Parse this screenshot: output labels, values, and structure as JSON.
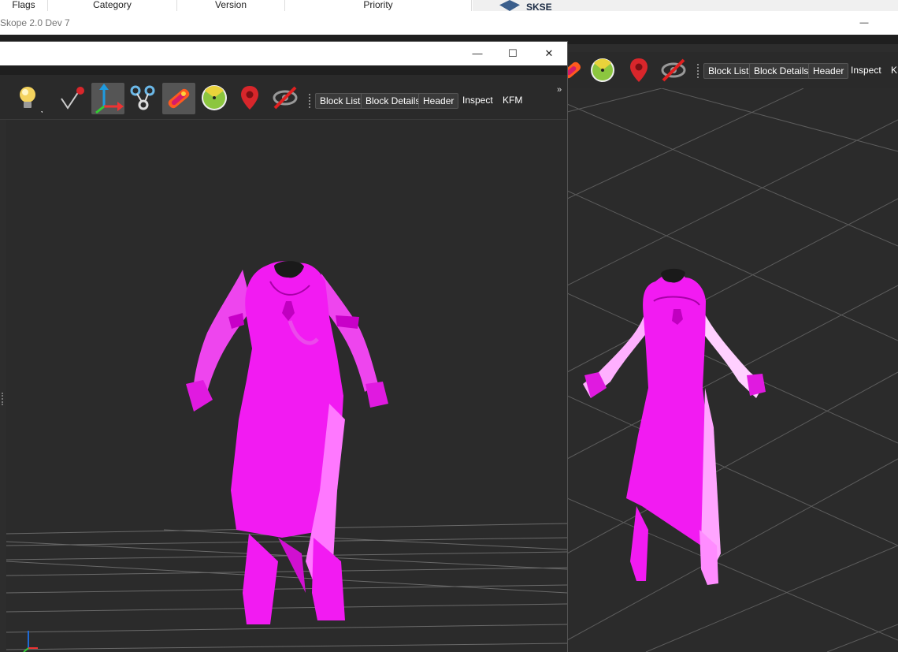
{
  "background_table": {
    "columns": [
      "Flags",
      "Category",
      "Version",
      "Priority"
    ]
  },
  "background_side": {
    "label": "SKSE",
    "icon": "skse-logo-icon"
  },
  "back_window": {
    "title": "Skope 2.0 Dev 7",
    "controls": {
      "minimize": "—",
      "maximize": "☐",
      "close": "✕"
    },
    "toolbar": {
      "buttons": [
        "Block List",
        "Block Details",
        "Header"
      ],
      "plain": [
        "Inspect",
        "KF"
      ]
    }
  },
  "front_window": {
    "controls": {
      "minimize": "—",
      "maximize": "☐",
      "close": "✕"
    },
    "toolbar": {
      "icons": [
        "lightbulb-icon",
        "vertex-pin-icon",
        "axes-transform-icon",
        "nodes-link-icon",
        "gradient-brush-icon",
        "radar-icon",
        "location-pin-icon",
        "hidden-eye-icon"
      ],
      "buttons": [
        "Block List",
        "Block Details",
        "Header"
      ],
      "plain": [
        "Inspect",
        "KFM"
      ],
      "overflow": "»"
    }
  },
  "colors": {
    "model": "#f21bf2",
    "viewport": "#2b2b2b",
    "grid": "#6a6a6a"
  }
}
